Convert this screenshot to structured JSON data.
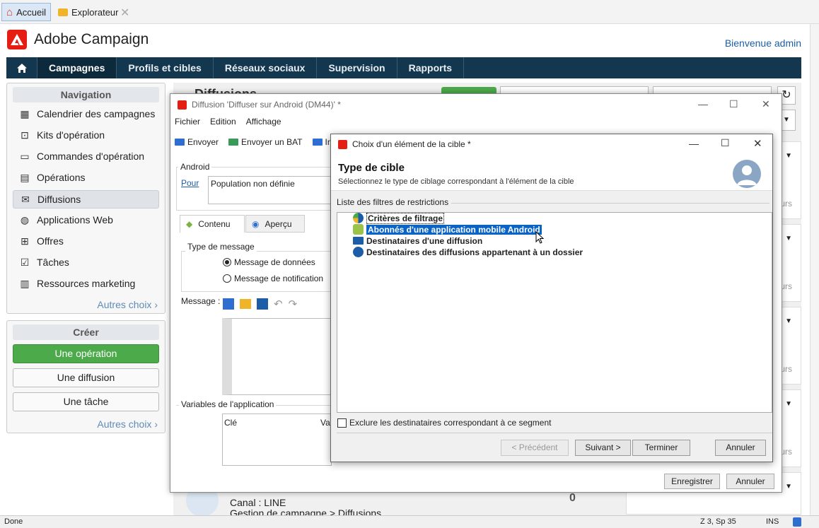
{
  "tabs": {
    "home": "Accueil",
    "explorer": "Explorateur"
  },
  "header": {
    "app_title": "Adobe Campaign",
    "welcome": "Bienvenue admin"
  },
  "nav": [
    "Campagnes",
    "Profils et cibles",
    "Réseaux sociaux",
    "Supervision",
    "Rapports"
  ],
  "sidebar": {
    "nav_title": "Navigation",
    "items": [
      {
        "label": "Calendrier des campagnes",
        "icon": "calendar-icon"
      },
      {
        "label": "Kits d'opération",
        "icon": "kit-icon"
      },
      {
        "label": "Commandes d'opération",
        "icon": "monitor-icon"
      },
      {
        "label": "Opérations",
        "icon": "board-icon"
      },
      {
        "label": "Diffusions",
        "icon": "envelope-icon"
      },
      {
        "label": "Applications Web",
        "icon": "globe-icon"
      },
      {
        "label": "Offres",
        "icon": "gift-icon"
      },
      {
        "label": "Tâches",
        "icon": "checkbox-icon"
      },
      {
        "label": "Ressources marketing",
        "icon": "books-icon"
      }
    ],
    "more": "Autres choix",
    "create_title": "Créer",
    "create_buttons": [
      "Une opération",
      "Une diffusion",
      "Une tâche"
    ],
    "create_more": "Autres choix"
  },
  "background": {
    "title_fragment": "Diffusions",
    "channel": "Canal : LINE",
    "path": "Gestion de campagne > Diffusions",
    "count_a": "0",
    "count_b": "0",
    "urs": "urs"
  },
  "delivery_window": {
    "title": "Diffusion 'Diffuser sur Android (DM44)' *",
    "menu": [
      "Fichier",
      "Edition",
      "Affichage"
    ],
    "toolbar": [
      "Envoyer",
      "Envoyer un BAT",
      "In"
    ],
    "android_label": "Android",
    "pour_link": "Pour",
    "population": "Population non définie",
    "tab_content": "Contenu",
    "tab_preview": "Aperçu",
    "message_type_label": "Type de message",
    "radio_data": "Message de données",
    "radio_notification": "Message de notification",
    "message_label": "Message :",
    "app_vars_label": "Variables de l'application",
    "col_key": "Clé",
    "col_val": "Val",
    "save": "Enregistrer",
    "cancel": "Annuler"
  },
  "dialog": {
    "title": "Choix d'un élément de la cible *",
    "heading": "Type de cible",
    "subheading": "Sélectionnez le type de ciblage correspondant à l'élément de la cible",
    "list_label": "Liste des filtres de restrictions",
    "items": [
      {
        "label": "Critères de filtrage",
        "icon": "filter-icon"
      },
      {
        "label": "Abonnés d'une application mobile Android",
        "icon": "android-icon",
        "selected": true
      },
      {
        "label": "Destinataires d'une diffusion",
        "icon": "envelope-icon"
      },
      {
        "label": "Destinataires des diffusions appartenant à un dossier",
        "icon": "folder-target-icon"
      }
    ],
    "exclude": "Exclure les destinataires correspondant à ce segment",
    "btn_prev": "< Précédent",
    "btn_next": "Suivant >",
    "btn_finish": "Terminer",
    "btn_cancel": "Annuler"
  },
  "status": {
    "left": "Done",
    "pos": "Z 3, Sp 35",
    "ins": "INS"
  },
  "colors": {
    "nav": "#12374e",
    "accent": "#e41e13",
    "selection": "#0a64c8",
    "green": "#4caa4a"
  }
}
